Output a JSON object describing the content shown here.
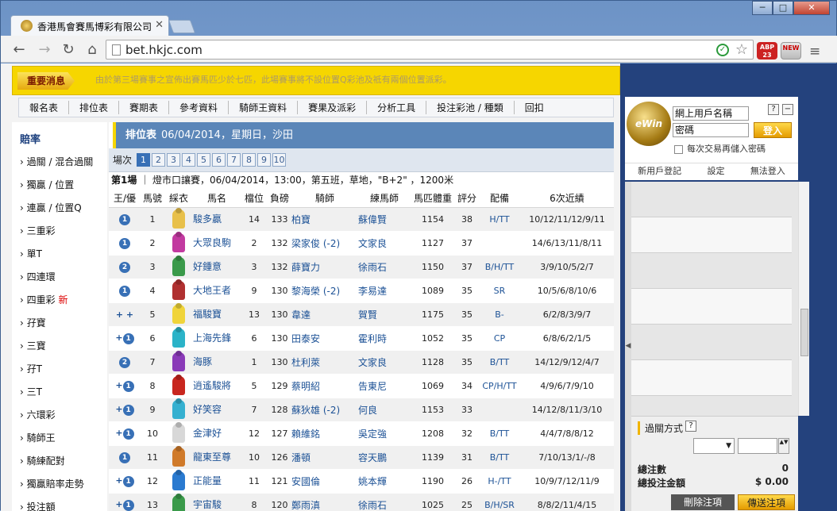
{
  "browser": {
    "tab_title": "香港馬會賽馬博彩有限公司",
    "url": "bet.hkjc.com",
    "window_buttons": {
      "min": "─",
      "max": "□",
      "close": "✕"
    },
    "ext_abp": "ABP 23",
    "ext_new": "NEW"
  },
  "notice": {
    "tag": "重要消息",
    "message": "由於第三場賽事之宣佈出賽馬匹少於七匹，此場賽事將不設位置Q彩池及祗有兩個位置派彩。"
  },
  "mainnav": [
    "報名表",
    "排位表",
    "賽期表",
    "參考資料",
    "騎師王資料",
    "賽果及派彩",
    "分析工具",
    "投注彩池 / 種類",
    "回扣"
  ],
  "leftnav": {
    "header": "賠率",
    "items": [
      {
        "label": "過關 / 混合過關"
      },
      {
        "label": "獨贏 / 位置"
      },
      {
        "label": "連贏 / 位置Q"
      },
      {
        "label": "三重彩"
      },
      {
        "label": "單T"
      },
      {
        "label": "四連環"
      },
      {
        "label": "四重彩",
        "badge": "新"
      },
      {
        "label": "孖寶"
      },
      {
        "label": "三寶"
      },
      {
        "label": "孖T"
      },
      {
        "label": "三T"
      },
      {
        "label": "六環彩"
      },
      {
        "label": "騎師王"
      },
      {
        "label": "騎練配對"
      },
      {
        "label": "獨贏賠率走勢"
      },
      {
        "label": "投注額"
      }
    ]
  },
  "main": {
    "title": "排位表",
    "subtitle": "06/04/2014，星期日，沙田",
    "race_label": "場次",
    "races": [
      "1",
      "2",
      "3",
      "4",
      "5",
      "6",
      "7",
      "8",
      "9",
      "10"
    ],
    "active_race": "1",
    "race_no": "第1場",
    "race_info": "｜ 燈市口讓賽，06/04/2014，13:00，第五班，草地，\"B+2\" ，1200米"
  },
  "table": {
    "headers": [
      "王/優",
      "馬號",
      "綵衣",
      "馬名",
      "檔位",
      "負磅",
      "騎師",
      "練馬師",
      "馬匹體重",
      "評分",
      "配備",
      "6次近績"
    ],
    "rows": [
      {
        "prefix": "",
        "circle": "1",
        "no": "1",
        "silk": "#e8c04a",
        "name": "駿多贏",
        "draw": "14",
        "wt": "133",
        "jockey": "柏寶",
        "trainer": "蘇偉賢",
        "body": "1154",
        "rating": "38",
        "gear": "H/TT",
        "form": "10/12/11/12/9/11"
      },
      {
        "prefix": "",
        "circle": "1",
        "no": "2",
        "silk": "#c23aa0",
        "name": "大眾良駒",
        "draw": "2",
        "wt": "132",
        "jockey": "梁家俊 (-2)",
        "trainer": "文家良",
        "body": "1127",
        "rating": "37",
        "gear": "",
        "form": "14/6/13/11/8/11"
      },
      {
        "prefix": "",
        "circle": "2",
        "no": "3",
        "silk": "#3a9a4a",
        "name": "好鍾意",
        "draw": "3",
        "wt": "132",
        "jockey": "薛寶力",
        "trainer": "徐雨石",
        "body": "1150",
        "rating": "37",
        "gear": "B/H/TT",
        "form": "3/9/10/5/2/7"
      },
      {
        "prefix": "",
        "circle": "1",
        "no": "4",
        "silk": "#b03030",
        "name": "大地王者",
        "draw": "9",
        "wt": "130",
        "jockey": "黎海榮 (-2)",
        "trainer": "李易達",
        "body": "1089",
        "rating": "35",
        "gear": "SR",
        "form": "10/5/6/8/10/6"
      },
      {
        "prefix": "+ +",
        "circle": "",
        "no": "5",
        "silk": "#f0d43a",
        "name": "福駿寶",
        "draw": "13",
        "wt": "130",
        "jockey": "韋達",
        "trainer": "賀賢",
        "body": "1175",
        "rating": "35",
        "gear": "B-",
        "form": "6/2/8/3/9/7"
      },
      {
        "prefix": "+",
        "circle": "1",
        "no": "6",
        "silk": "#2bb3c8",
        "name": "上海先鋒",
        "draw": "6",
        "wt": "130",
        "jockey": "田泰安",
        "trainer": "霍利時",
        "body": "1052",
        "rating": "35",
        "gear": "CP",
        "form": "6/8/6/2/1/5"
      },
      {
        "prefix": "",
        "circle": "2",
        "no": "7",
        "silk": "#8a3ab8",
        "name": "海豚",
        "draw": "1",
        "wt": "130",
        "jockey": "杜利萊",
        "trainer": "文家良",
        "body": "1128",
        "rating": "35",
        "gear": "B/TT",
        "form": "14/12/9/12/4/7"
      },
      {
        "prefix": "+",
        "circle": "1",
        "no": "8",
        "silk": "#c8261e",
        "name": "逍遙駿將",
        "draw": "5",
        "wt": "129",
        "jockey": "蔡明紹",
        "trainer": "告東尼",
        "body": "1069",
        "rating": "34",
        "gear": "CP/H/TT",
        "form": "4/9/6/7/9/10"
      },
      {
        "prefix": "+",
        "circle": "1",
        "no": "9",
        "silk": "#35b0d0",
        "name": "好笑容",
        "draw": "7",
        "wt": "128",
        "jockey": "蘇狄雄 (-2)",
        "trainer": "何良",
        "body": "1153",
        "rating": "33",
        "gear": "",
        "form": "14/12/8/11/3/10"
      },
      {
        "prefix": "+",
        "circle": "1",
        "no": "10",
        "silk": "#d8d8d8",
        "name": "金津好",
        "draw": "12",
        "wt": "127",
        "jockey": "賴維銘",
        "trainer": "吳定強",
        "body": "1208",
        "rating": "32",
        "gear": "B/TT",
        "form": "4/4/7/8/8/12"
      },
      {
        "prefix": "",
        "circle": "1",
        "no": "11",
        "silk": "#d07a2a",
        "name": "龍東至尊",
        "draw": "10",
        "wt": "126",
        "jockey": "潘頓",
        "trainer": "容天鵬",
        "body": "1139",
        "rating": "31",
        "gear": "B/TT",
        "form": "7/10/13/1/-/8"
      },
      {
        "prefix": "+",
        "circle": "1",
        "no": "12",
        "silk": "#2a7ad0",
        "name": "正能量",
        "draw": "11",
        "wt": "121",
        "jockey": "安國倫",
        "trainer": "姚本輝",
        "body": "1190",
        "rating": "26",
        "gear": "H-/TT",
        "form": "10/9/7/12/11/9"
      },
      {
        "prefix": "+",
        "circle": "1",
        "no": "13",
        "silk": "#3a9a4a",
        "name": "宇宙駿",
        "draw": "8",
        "wt": "120",
        "jockey": "鄭雨滇",
        "trainer": "徐雨石",
        "body": "1025",
        "rating": "25",
        "gear": "B/H/SR",
        "form": "8/8/2/11/4/15"
      }
    ]
  },
  "login": {
    "logo": "eWin",
    "username_ph": "網上用戶名稱",
    "password_ph": "密碼",
    "help": "?",
    "minus": "−",
    "login_btn": "登入",
    "save_pw": "每次交易再儲入密碼",
    "links": [
      "新用戶登記",
      "設定",
      "無法登入"
    ]
  },
  "betslip": {
    "mode_label": "過關方式",
    "help": "?",
    "count_label": "總注數",
    "count_value": "0",
    "amount_label": "總投注金額",
    "amount_value": "$ 0.00",
    "delete_btn": "刪除注項",
    "send_btn": "傳送注項",
    "select_arrow": "▼",
    "spin": "▲▼",
    "collapse_arrow": "◀"
  }
}
